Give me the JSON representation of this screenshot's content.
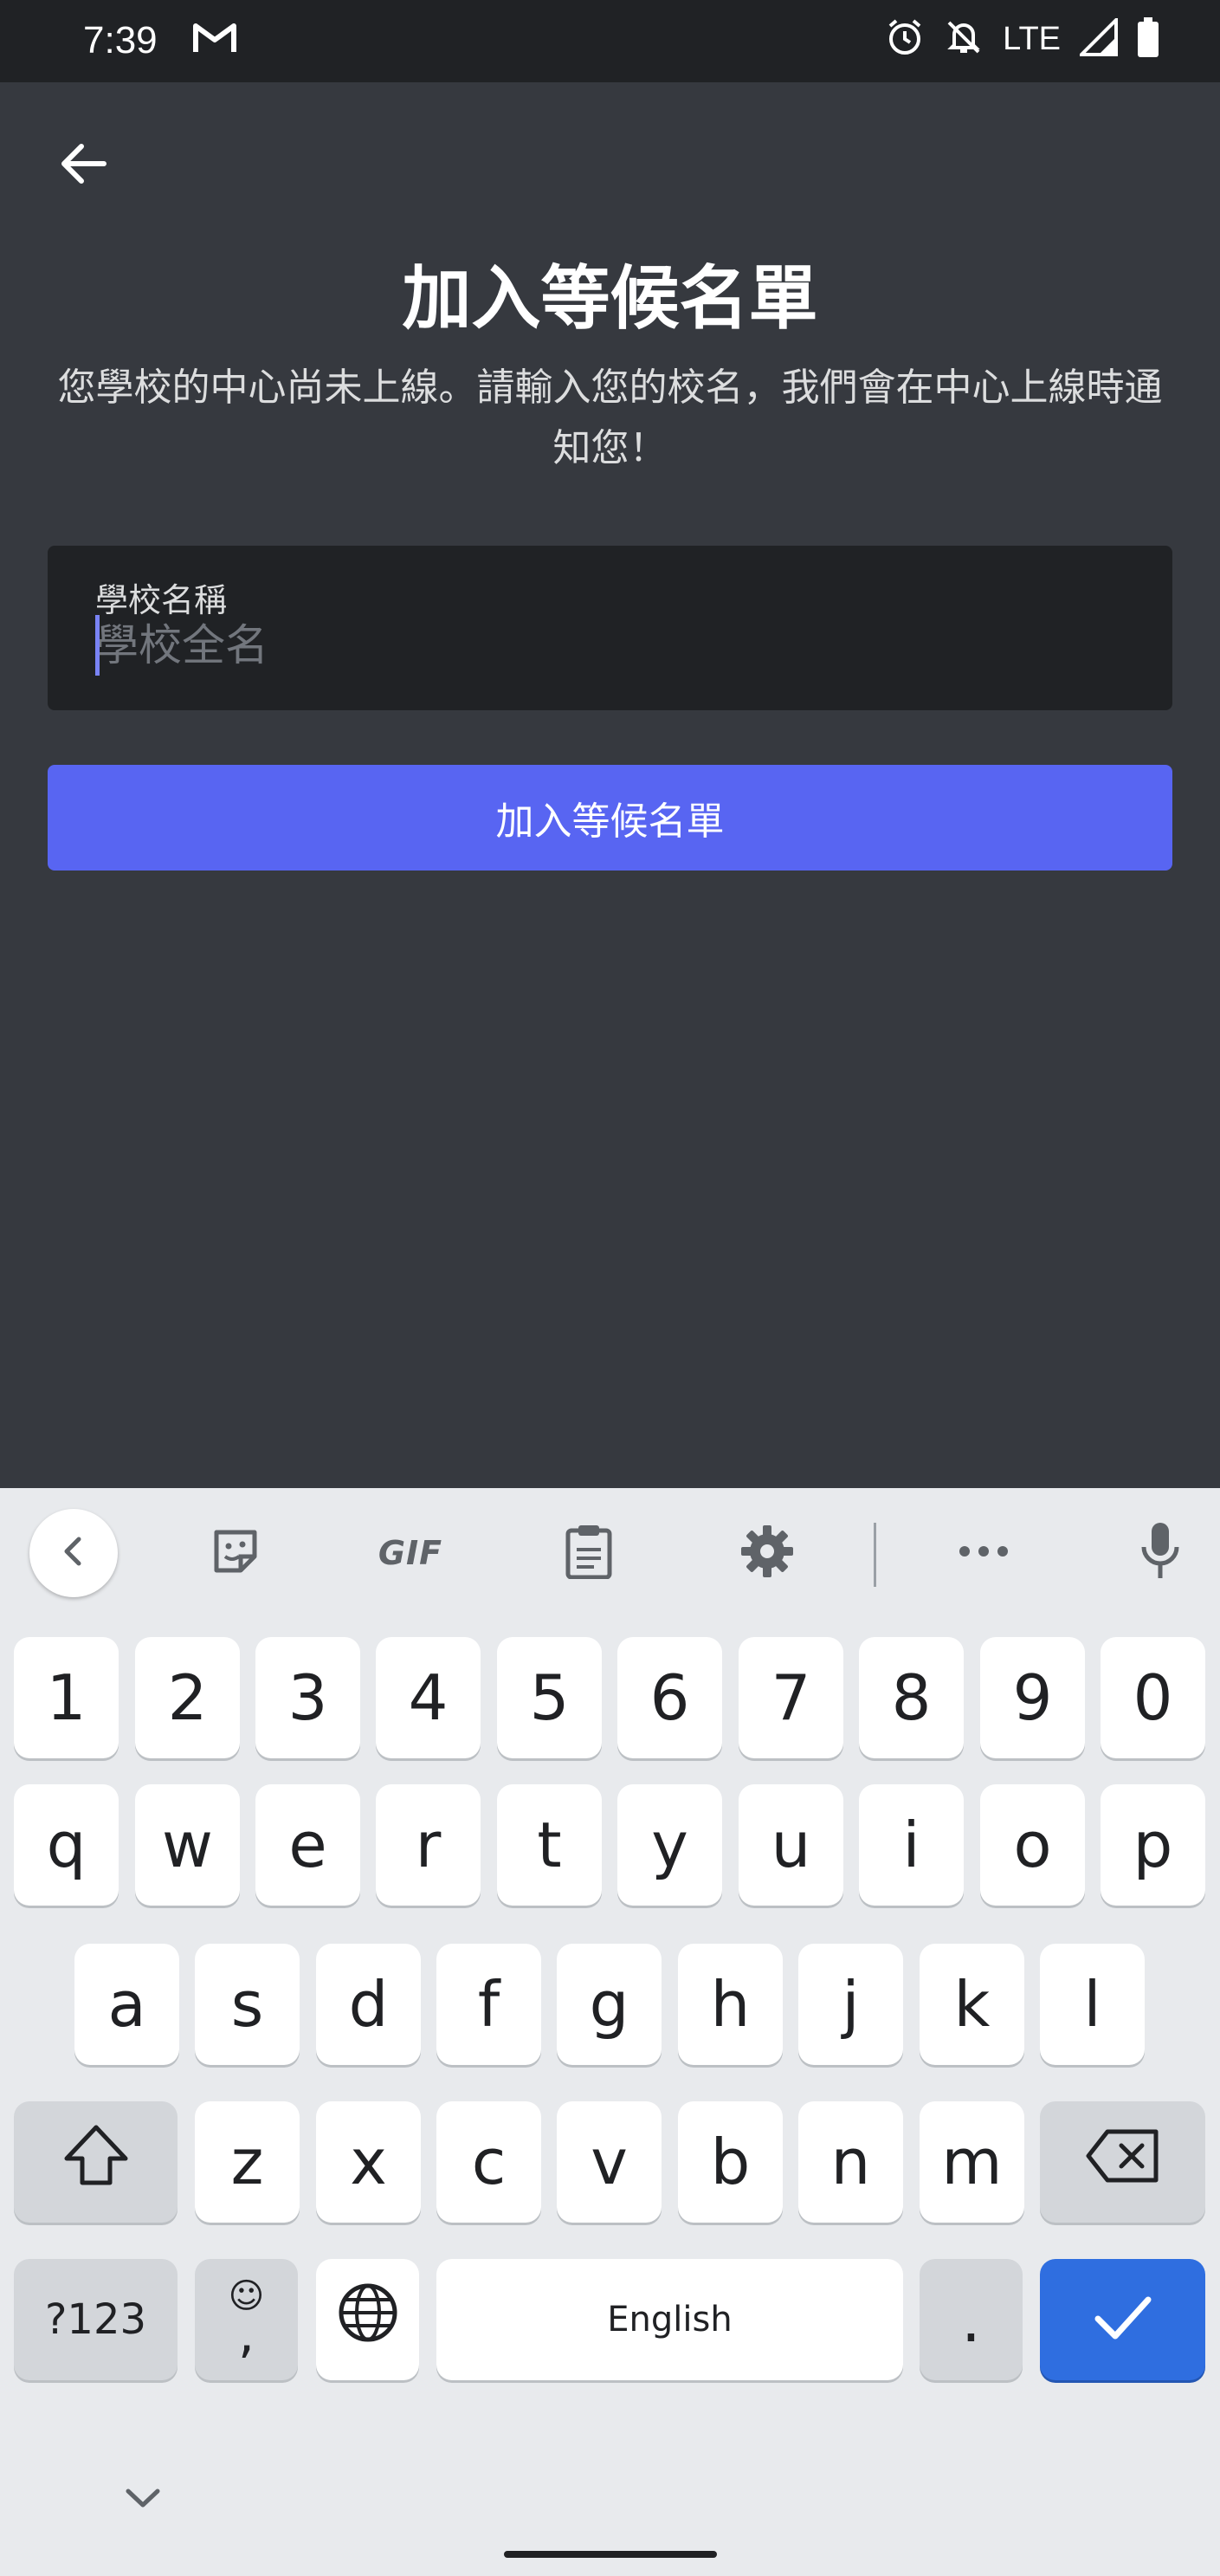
{
  "status_bar": {
    "time": "7:39",
    "network": "LTE"
  },
  "header": {
    "title": "加入等候名單",
    "subtitle": "您學校的中心尚未上線。請輸入您的校名，我們會在中心上線時通知您！"
  },
  "form": {
    "school_label": "學校名稱",
    "school_placeholder": "學校全名",
    "school_value": "",
    "submit_label": "加入等候名單"
  },
  "keyboard": {
    "toolbar": [
      "collapse",
      "sticker",
      "GIF",
      "clipboard",
      "settings",
      "more",
      "voice"
    ],
    "gif_label": "GIF",
    "row_numbers": [
      "1",
      "2",
      "3",
      "4",
      "5",
      "6",
      "7",
      "8",
      "9",
      "0"
    ],
    "row_1": [
      "q",
      "w",
      "e",
      "r",
      "t",
      "y",
      "u",
      "i",
      "o",
      "p"
    ],
    "row_2": [
      "a",
      "s",
      "d",
      "f",
      "g",
      "h",
      "j",
      "k",
      "l"
    ],
    "row_3": [
      "z",
      "x",
      "c",
      "v",
      "b",
      "n",
      "m"
    ],
    "symbols_label": "?123",
    "emoji_label": "☺",
    "comma_label": ",",
    "space_label": "English",
    "period_label": "."
  },
  "colors": {
    "accent": "#5865f2",
    "background": "#36393f",
    "input_bg": "#202225",
    "enter_key": "#2f6ee0"
  }
}
